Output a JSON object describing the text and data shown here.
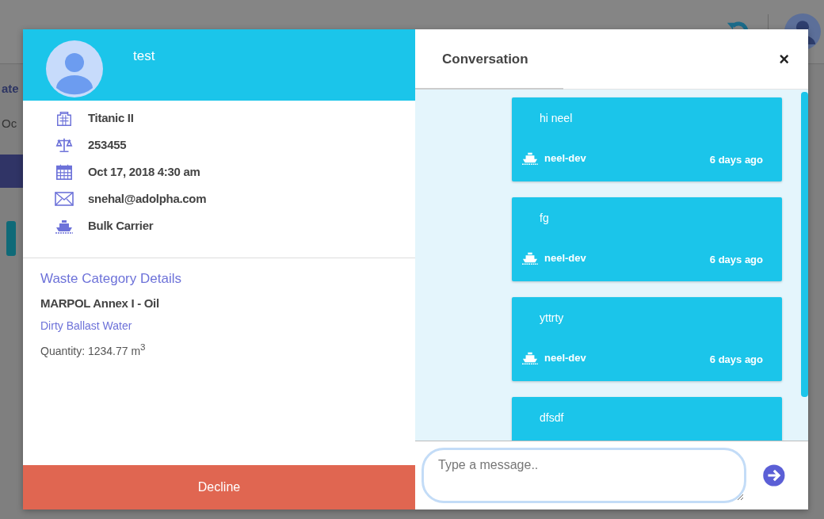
{
  "background": {
    "fragments": [
      "ate",
      "Oc"
    ]
  },
  "details_panel": {
    "name": "test",
    "details": [
      {
        "kind": "building",
        "text": "Titanic II"
      },
      {
        "kind": "scale",
        "text": "253455"
      },
      {
        "kind": "calendar",
        "text": "Oct 17, 2018 4:30 am"
      },
      {
        "kind": "envelope",
        "text": "snehal@adolpha.com"
      },
      {
        "kind": "ship",
        "text": "Bulk Carrier"
      }
    ],
    "waste_section": {
      "title": "Waste Category Details",
      "category": "MARPOL Annex I - Oil",
      "subcategory": "Dirty Ballast Water",
      "quantity": "Quantity: 1234.77 m$^{3}$"
    },
    "decline_button": "Decline"
  },
  "conversation": {
    "title": "Conversation",
    "close": "×",
    "messages": [
      {
        "text": "hi neel",
        "sender": "neel-dev",
        "time": "6 days ago"
      },
      {
        "text": "fg",
        "sender": "neel-dev",
        "time": "6 days ago"
      },
      {
        "text": "yttrty",
        "sender": "neel-dev",
        "time": "6 days ago"
      },
      {
        "text": "dfsdf"
      }
    ],
    "input": {
      "placeholder": "Type a message.."
    }
  }
}
